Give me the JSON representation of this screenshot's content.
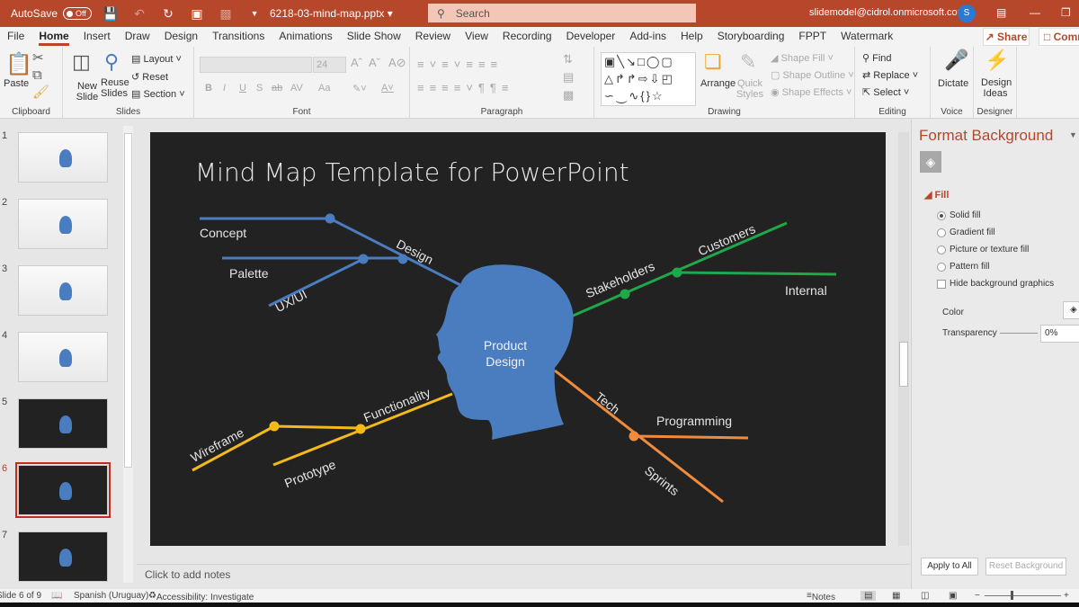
{
  "titlebar": {
    "autosave_label": "AutoSave",
    "autosave_state": "Off",
    "document_title": "6218-03-mind-map.pptx",
    "search_placeholder": "Search",
    "account": "slidemodel@cidrol.onmicrosoft.com",
    "avatar_initial": "S"
  },
  "tabs": [
    "File",
    "Home",
    "Insert",
    "Draw",
    "Design",
    "Transitions",
    "Animations",
    "Slide Show",
    "Review",
    "View",
    "Recording",
    "Developer",
    "Add-ins",
    "Help",
    "Storyboarding",
    "FPPT",
    "Watermark"
  ],
  "active_tab": "Home",
  "share_label": "Share",
  "comments_label": "Comments",
  "ribbon": {
    "clipboard": {
      "paste": "Paste",
      "label": "Clipboard"
    },
    "slides": {
      "new_slide": "New Slide",
      "reuse_slides": "Reuse Slides",
      "layout": "Layout",
      "reset": "Reset",
      "section": "Section",
      "label": "Slides"
    },
    "font": {
      "size": "24",
      "label": "Font",
      "bold": "B",
      "italic": "I",
      "underline": "U",
      "shadow": "S",
      "spacing": "AV",
      "case": "Aa"
    },
    "paragraph": {
      "label": "Paragraph"
    },
    "drawing": {
      "arrange": "Arrange",
      "quick_styles": "Quick Styles",
      "shape_fill": "Shape Fill",
      "shape_outline": "Shape Outline",
      "shape_effects": "Shape Effects",
      "label": "Drawing"
    },
    "editing": {
      "find": "Find",
      "replace": "Replace",
      "select": "Select",
      "label": "Editing"
    },
    "voice": {
      "dictate": "Dictate",
      "label": "Voice"
    },
    "designer": {
      "design_ideas": "Design Ideas",
      "label": "Designer"
    }
  },
  "thumbnails": [
    {
      "num": "1",
      "theme": "light"
    },
    {
      "num": "2",
      "theme": "light"
    },
    {
      "num": "3",
      "theme": "light"
    },
    {
      "num": "4",
      "theme": "light"
    },
    {
      "num": "5",
      "theme": "dark"
    },
    {
      "num": "6",
      "theme": "dark",
      "selected": true
    },
    {
      "num": "7",
      "theme": "dark"
    }
  ],
  "slide": {
    "title": "Mind Map Template for PowerPoint",
    "center": {
      "line1": "Product",
      "line2": "Design",
      "color": "#4a7cc0"
    },
    "branches": {
      "design": {
        "label": "Design",
        "color": "#4a7cc0",
        "children": [
          "Concept",
          "Palette",
          "UX/UI"
        ]
      },
      "stakeholders": {
        "label": "Stakeholders",
        "color": "#1fa84a",
        "children": [
          "Customers",
          "Internal"
        ]
      },
      "functionality": {
        "label": "Functionality",
        "color": "#f4b91a",
        "children": [
          "Wireframe",
          "Prototype"
        ]
      },
      "tech": {
        "label": "Tech",
        "color": "#f08a3c",
        "children": [
          "Programming",
          "Sprints"
        ]
      }
    }
  },
  "notes_placeholder": "Click to add notes",
  "format_pane": {
    "title": "Format Background",
    "section": "Fill",
    "options": [
      "Solid fill",
      "Gradient fill",
      "Picture or texture fill",
      "Pattern fill"
    ],
    "selected_option": "Solid fill",
    "hide_bg_graphics": "Hide background graphics",
    "color_label": "Color",
    "transparency_label": "Transparency",
    "transparency_value": "0%",
    "apply_all": "Apply to All",
    "reset_bg": "Reset Background"
  },
  "statusbar": {
    "slide_info": "Slide 6 of 9",
    "language": "Spanish (Uruguay)",
    "accessibility": "Accessibility: Investigate",
    "notes": "Notes"
  }
}
